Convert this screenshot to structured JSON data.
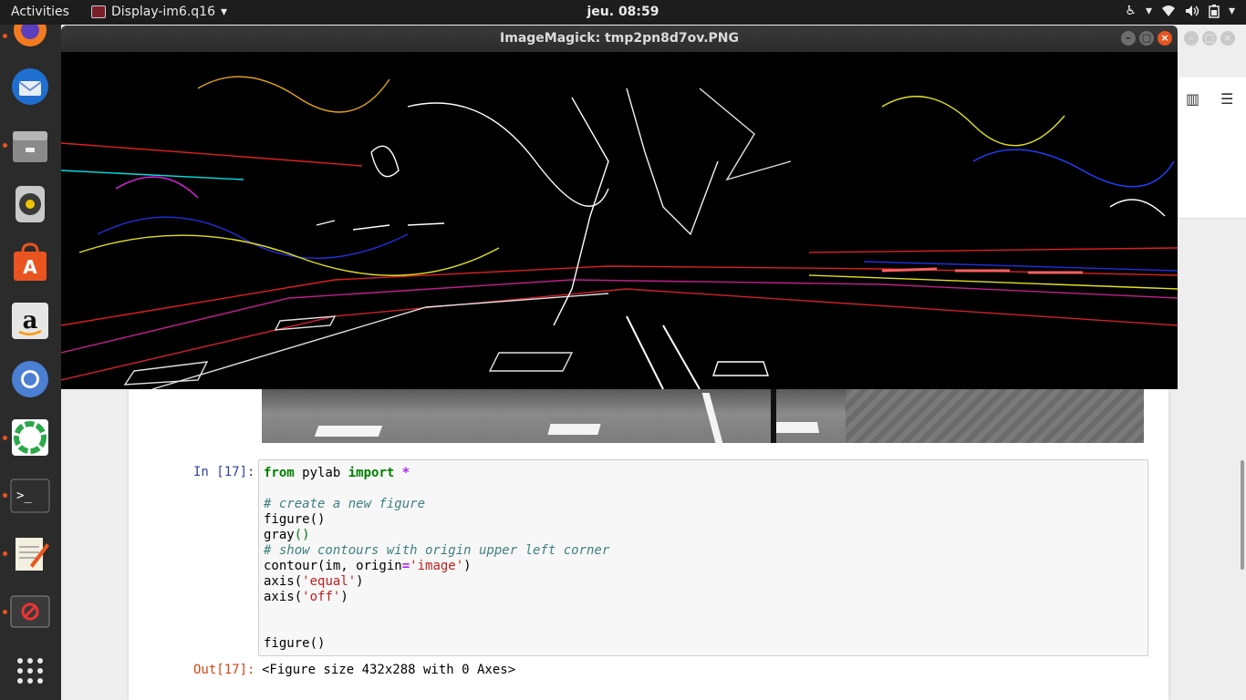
{
  "topbar": {
    "activities": "Activities",
    "app_menu": "Display-im6.q16",
    "clock": "jeu. 08:59"
  },
  "dock": {
    "items": [
      "firefox-icon",
      "thunderbird-icon",
      "files-icon",
      "rhythmbox-icon",
      "software-center-icon",
      "amazon-icon",
      "chromium-icon",
      "app-icon",
      "terminal-icon",
      "text-editor-icon",
      "app-blocked-icon",
      "show-apps-icon"
    ]
  },
  "imagemagick": {
    "title": "ImageMagick: tmp2pn8d7ov.PNG"
  },
  "notebook": {
    "in_prompt": "In [17]:",
    "out_prompt": "Out[17]:",
    "output_text": "<Figure size 432x288 with 0 Axes>",
    "code": {
      "l1_kw1": "from",
      "l1_mod": " pylab ",
      "l1_kw2": "import",
      "l1_op": " *",
      "l3": "# create a new figure",
      "l4": "figure()",
      "l5a": "gray",
      "l5b": "()",
      "l6": "# show contours with origin upper left corner",
      "l7a": "contour(im, origin",
      "l7b": "=",
      "l7c": "'image'",
      "l7d": ")",
      "l8a": "axis(",
      "l8b": "'equal'",
      "l8c": ")",
      "l9a": "axis(",
      "l9b": "'off'",
      "l9c": ")",
      "l12": "figure()"
    }
  },
  "colors": {
    "accent": "#e95420",
    "prompt_in": "#303f9f",
    "prompt_out": "#d84315",
    "keyword": "#008000",
    "comment": "#408080",
    "string": "#ba2121"
  }
}
